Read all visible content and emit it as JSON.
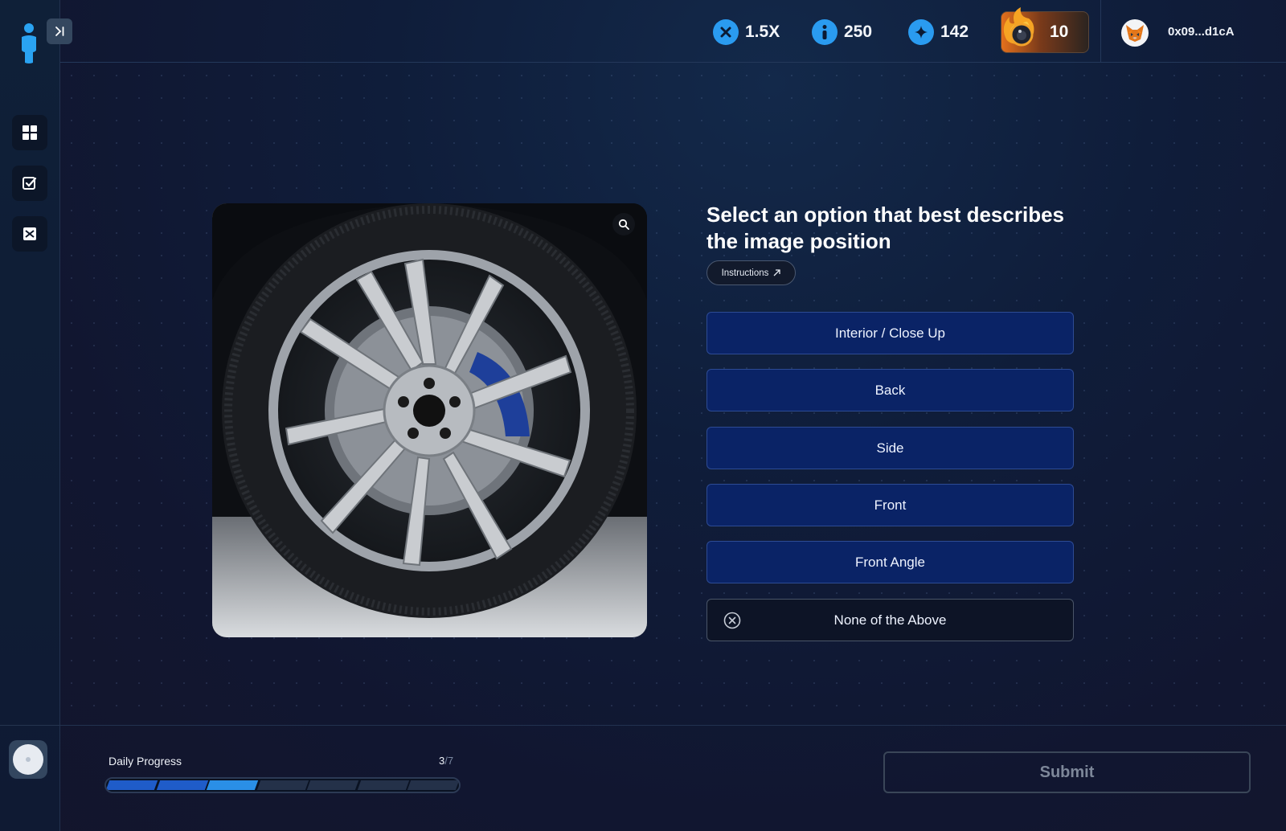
{
  "header": {
    "stats": [
      {
        "icon": "multiplier-icon",
        "value": "1.5X"
      },
      {
        "icon": "info-icon",
        "value": "250"
      },
      {
        "icon": "sparkle-icon",
        "value": "142"
      }
    ],
    "streak": {
      "icon": "flame-icon",
      "value": "10"
    },
    "wallet": {
      "icon": "metamask-fox-icon",
      "address": "0x09...d1cA"
    }
  },
  "sidebar": {
    "items": [
      {
        "icon": "dashboard-grid-icon"
      },
      {
        "icon": "checklist-icon"
      },
      {
        "icon": "image-task-icon"
      }
    ],
    "collapse_icon": "collapse-sidebar-icon"
  },
  "task": {
    "question": "Select an option that best describes the image position",
    "instructions_label": "Instructions",
    "image_alt": "Car wheel with alloy rim and blue brake caliper",
    "options": [
      "Interior / Close Up",
      "Back",
      "Side",
      "Front",
      "Front Angle"
    ],
    "none_option": "None of the Above"
  },
  "footer": {
    "progress_label": "Daily Progress",
    "progress_current": "3",
    "progress_total": "/7",
    "progress_fraction": 0.4286,
    "submit_label": "Submit"
  },
  "colors": {
    "accent": "#2a9bf0",
    "option_bg": "#0a2366",
    "streak_orange": "#e3701c"
  }
}
